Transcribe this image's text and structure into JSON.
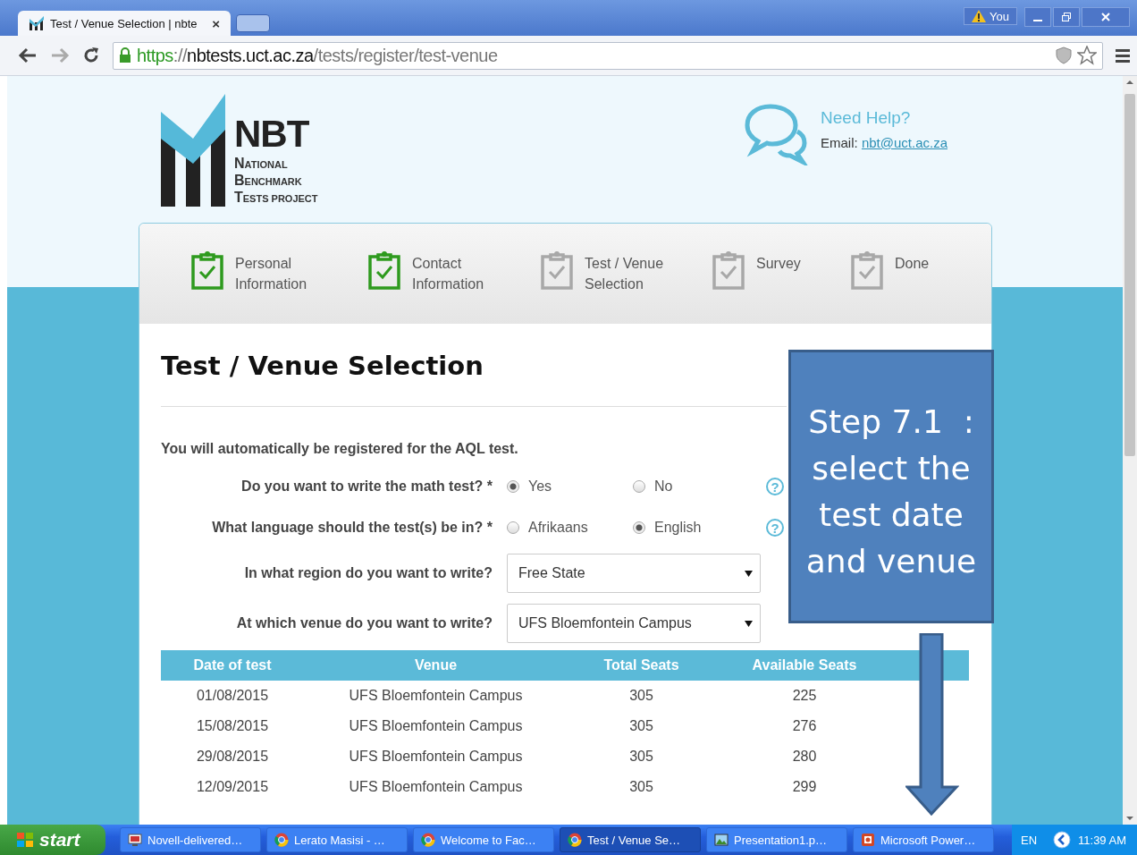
{
  "browser": {
    "tab_title": "Test / Venue Selection | nbte",
    "tab_close": "×",
    "user_badge": "You",
    "url": {
      "scheme": "https",
      "separator": "://",
      "host": "nbtests.uct.ac.za",
      "path": "/tests/register/test-venue"
    }
  },
  "logo": {
    "title": "NBT",
    "lines": [
      "NATIONAL",
      "BENCHMARK",
      "TESTS PROJECT"
    ]
  },
  "help": {
    "title": "Need Help?",
    "email_label": "Email:",
    "email": "nbt@uct.ac.za"
  },
  "steps": [
    {
      "label": "Personal Information",
      "done": true
    },
    {
      "label": "Contact Information",
      "done": true
    },
    {
      "label": "Test / Venue Selection",
      "done": false
    },
    {
      "label": "Survey",
      "done": false
    },
    {
      "label": "Done",
      "done": false
    }
  ],
  "page_title": "Test / Venue Selection",
  "notice": "You will automatically be registered for the AQL test.",
  "questions": [
    {
      "kind": "radio",
      "label": "Do you want to write the math test? *",
      "help": "?",
      "options": [
        {
          "label": "Yes",
          "selected": true
        },
        {
          "label": "No",
          "selected": false
        }
      ]
    },
    {
      "kind": "radio",
      "label": "What language should the test(s) be in? *",
      "help": "?",
      "options": [
        {
          "label": "Afrikaans",
          "selected": false
        },
        {
          "label": "English",
          "selected": true
        }
      ]
    },
    {
      "kind": "select",
      "label": "In what region do you want to write?",
      "value": "Free State"
    },
    {
      "kind": "select",
      "label": "At which venue do you want to write?",
      "value": "UFS Bloemfontein Campus"
    }
  ],
  "table": {
    "columns": [
      "Date of test",
      "Venue",
      "Total Seats",
      "Available Seats"
    ],
    "rows": [
      [
        "01/08/2015",
        "UFS Bloemfontein Campus",
        "305",
        "225"
      ],
      [
        "15/08/2015",
        "UFS Bloemfontein Campus",
        "305",
        "276"
      ],
      [
        "29/08/2015",
        "UFS Bloemfontein Campus",
        "305",
        "280"
      ],
      [
        "12/09/2015",
        "UFS Bloemfontein Campus",
        "305",
        "299"
      ]
    ]
  },
  "callout": {
    "heading": "Step 7.1  :",
    "text": "select the test date and venue"
  },
  "taskbar": {
    "start": "start",
    "items": [
      {
        "label": "Novell-delivered…",
        "kind": "app",
        "selected": false
      },
      {
        "label": "Lerato Masisi - …",
        "kind": "browser",
        "selected": false
      },
      {
        "label": "Welcome to Fac…",
        "kind": "browser",
        "selected": false
      },
      {
        "label": "Test / Venue Se…",
        "kind": "browser",
        "selected": true
      },
      {
        "label": "Presentation1.p…",
        "kind": "image",
        "selected": false
      },
      {
        "label": "Microsoft Power…",
        "kind": "slides",
        "selected": false
      }
    ],
    "language": "EN",
    "clock": "11:39 AM"
  }
}
